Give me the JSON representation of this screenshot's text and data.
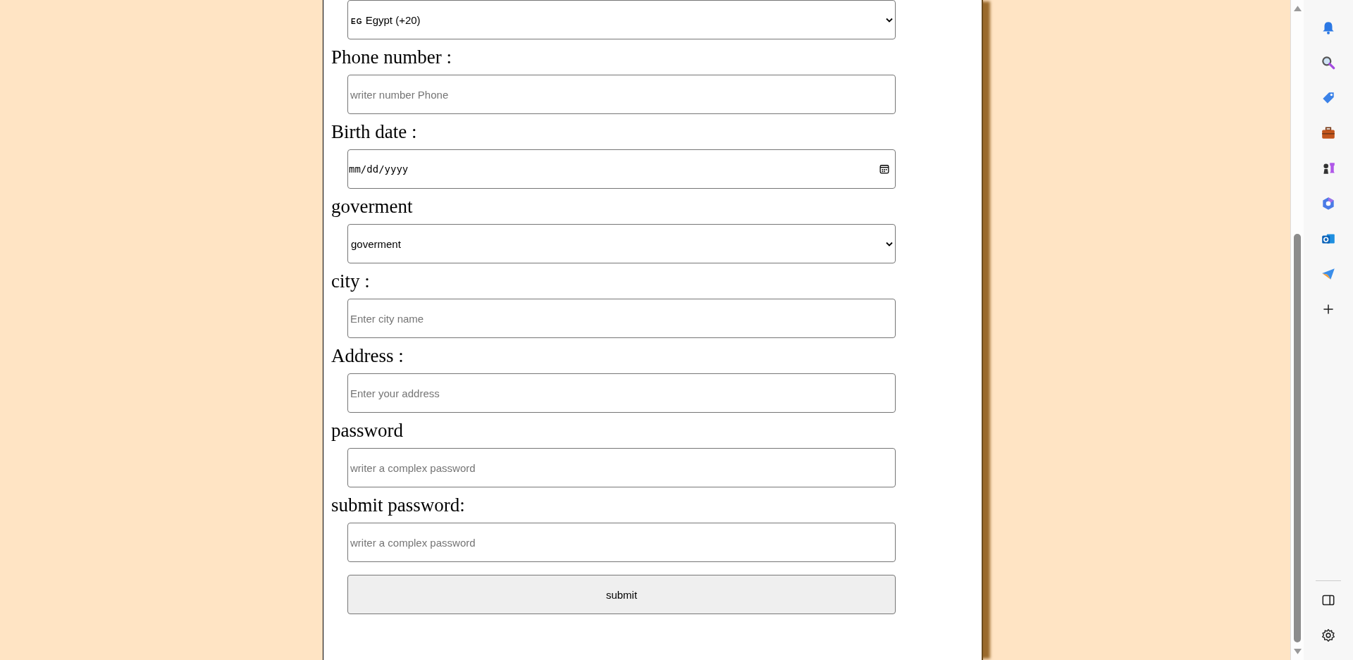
{
  "form": {
    "fields": [
      {
        "kind": "select",
        "flag": "EG",
        "value": "Egypt (+20)"
      },
      {
        "kind": "text",
        "label": "Phone number :",
        "placeholder": "writer number Phone"
      },
      {
        "kind": "date",
        "label": "Birth date :",
        "placeholder": "mm/dd/yyyy"
      },
      {
        "kind": "select",
        "label": "goverment",
        "value": "goverment"
      },
      {
        "kind": "text",
        "label": "city :",
        "placeholder": "Enter city name"
      },
      {
        "kind": "text",
        "label": "Address :",
        "placeholder": "Enter your address"
      },
      {
        "kind": "password",
        "label": "password",
        "placeholder": "writer a complex password"
      },
      {
        "kind": "password",
        "label": "submit password:",
        "placeholder": "writer a complex password"
      }
    ],
    "submit_button": "submit"
  },
  "sidebar": {
    "items": [
      {
        "kind": "bell"
      },
      {
        "kind": "search"
      },
      {
        "kind": "tag"
      },
      {
        "kind": "briefcase"
      },
      {
        "kind": "chess"
      },
      {
        "kind": "hexagon"
      },
      {
        "kind": "mail"
      },
      {
        "kind": "plane"
      },
      {
        "kind": "add"
      }
    ],
    "bottom_items": [
      {
        "kind": "panel"
      },
      {
        "kind": "settings"
      }
    ]
  }
}
